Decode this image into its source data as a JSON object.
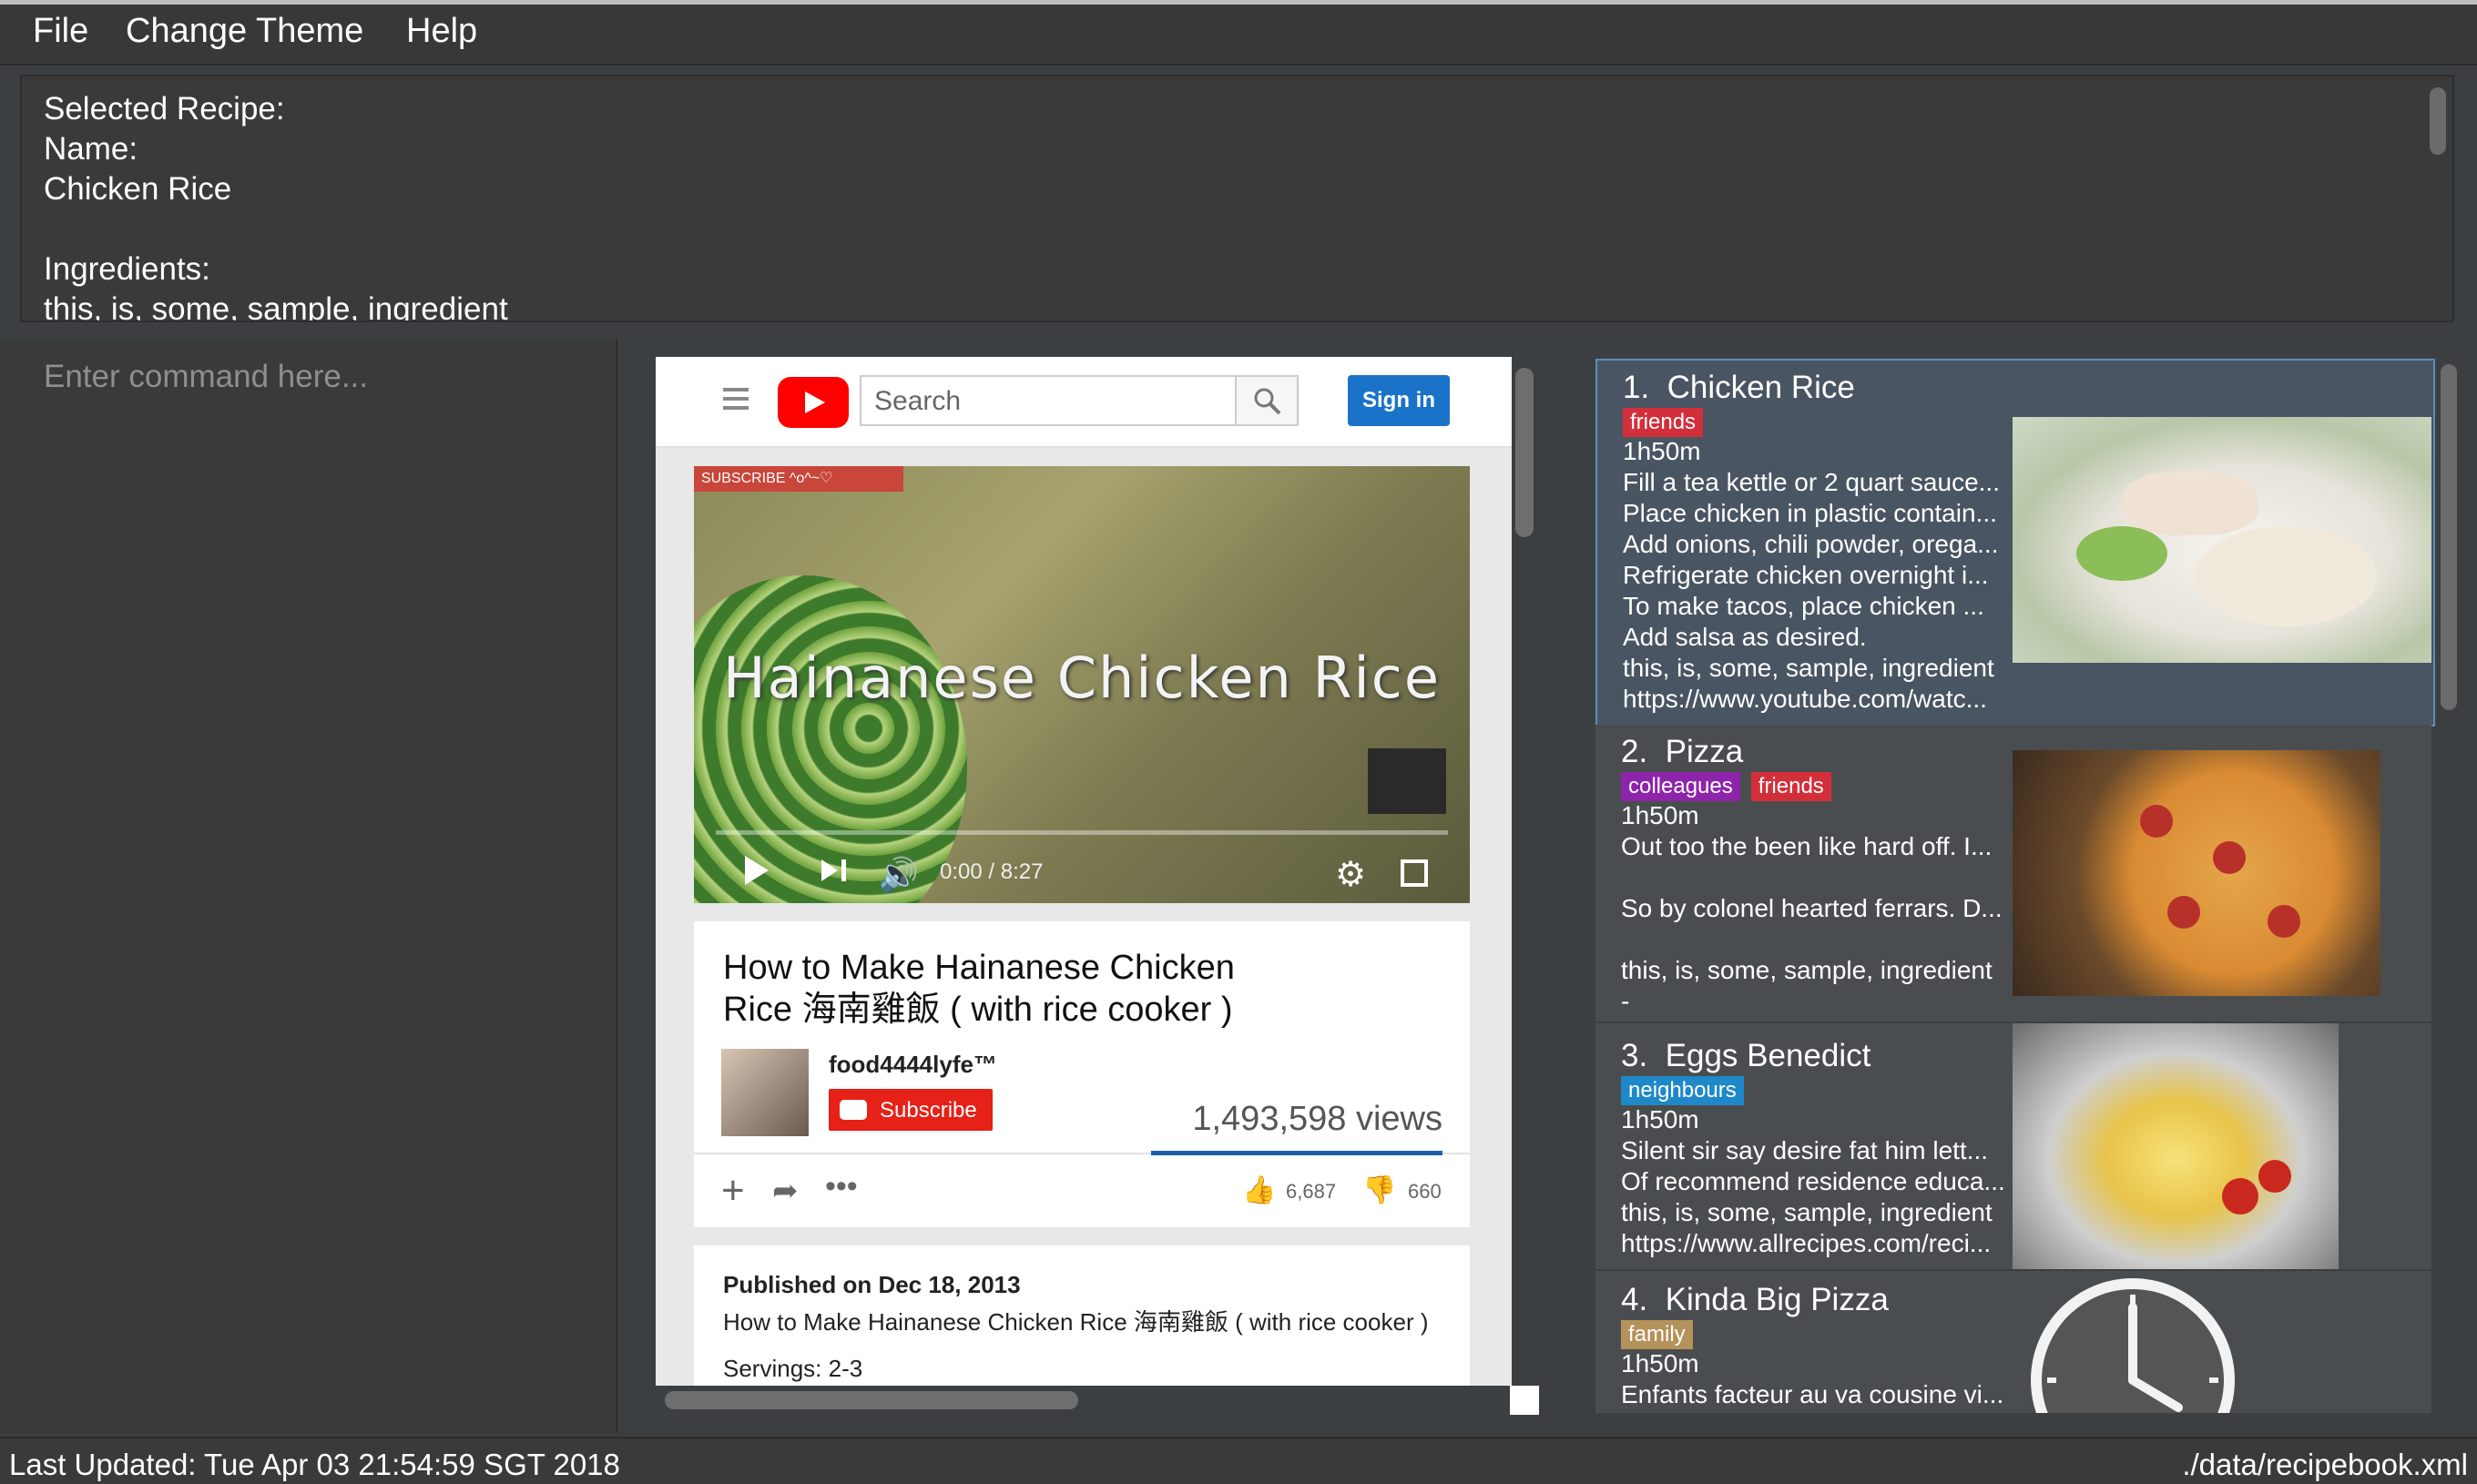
{
  "menu": {
    "file": "File",
    "theme": "Change Theme",
    "help": "Help"
  },
  "result": {
    "text": "Selected Recipe:\nName:\nChicken Rice\n\nIngredients:\nthis, is, some, sample, ingredient"
  },
  "command": {
    "placeholder": "Enter command here..."
  },
  "browser": {
    "search_placeholder": "Search",
    "sign_in": "Sign in",
    "video_overlay_title": "Hainanese Chicken Rice",
    "subscribe_banner": "SUBSCRIBE ^o^~♡",
    "time": "0:00 / 8:27",
    "video_title": "How to Make Hainanese Chicken Rice 海南雞飯 ( with rice cooker )",
    "channel": "food4444lyfe™",
    "subscribe": "Subscribe",
    "views": "1,493,598 views",
    "likes": "6,687",
    "dislikes": "660",
    "published": "Published on Dec 18, 2013",
    "description": "How to Make Hainanese Chicken Rice 海南雞飯 ( with rice cooker )",
    "servings": "Servings: 2-3"
  },
  "recipes": [
    {
      "index": "1.",
      "name": "Chicken Rice",
      "tags": [
        {
          "label": "friends",
          "color": "#d32f3a"
        }
      ],
      "lines": [
        "1h50m",
        "Fill a tea kettle or 2 quart sauce...",
        "Place chicken in plastic contain...",
        "Add onions, chili powder, orega...",
        "Refrigerate chicken overnight i...",
        "To make tacos, place chicken ...",
        "Add salsa as desired.",
        "this, is, some, sample, ingredient",
        "https://www.youtube.com/watc..."
      ]
    },
    {
      "index": "2.",
      "name": "Pizza",
      "tags": [
        {
          "label": "colleagues",
          "color": "#8e24aa"
        },
        {
          "label": "friends",
          "color": "#d32f3a"
        }
      ],
      "lines": [
        "1h50m",
        "Out too the been like hard off. I...",
        "",
        "So by colonel hearted ferrars. D...",
        "",
        "this, is, some, sample, ingredient",
        "-"
      ]
    },
    {
      "index": "3.",
      "name": "Eggs Benedict",
      "tags": [
        {
          "label": "neighbours",
          "color": "#1e88c8"
        }
      ],
      "lines": [
        "1h50m",
        "Silent sir say desire fat him lett...",
        "Of recommend residence educa...",
        "this, is, some, sample, ingredient",
        "https://www.allrecipes.com/reci..."
      ]
    },
    {
      "index": "4.",
      "name": "Kinda Big Pizza",
      "tags": [
        {
          "label": "family",
          "color": "#b5925a"
        }
      ],
      "lines": [
        "1h50m",
        "Enfants facteur au va cousine vi..."
      ]
    }
  ],
  "status": {
    "last_updated": "Last Updated: Tue Apr 03 21:54:59 SGT 2018",
    "file_path": "./data/recipebook.xml"
  },
  "colors": {
    "app_bg": "#3c3f41",
    "selected_card": "#4a5563",
    "card": "#4a4d50",
    "youtube_red": "#ff0000",
    "signin_blue": "#1a73c9"
  }
}
